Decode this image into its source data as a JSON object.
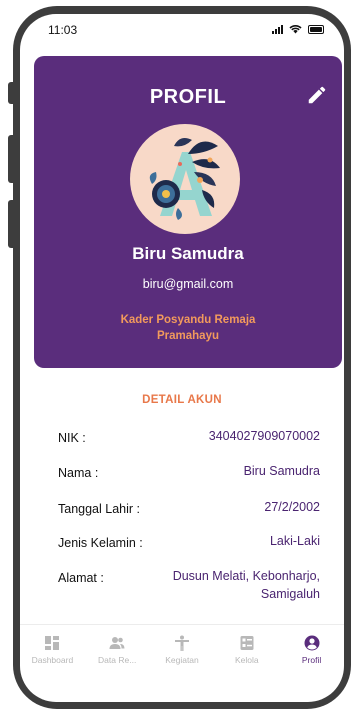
{
  "status_bar": {
    "time": "11:03"
  },
  "profile": {
    "title": "PROFIL",
    "name": "Biru Samudra",
    "email": "biru@gmail.com",
    "role_line1": "Kader Posyandu Remaja",
    "role_line2": "Pramahayu"
  },
  "details": {
    "heading": "DETAIL AKUN",
    "rows": [
      {
        "label": "NIK :",
        "value": "3404027909070002"
      },
      {
        "label": "Nama :",
        "value": "Biru Samudra"
      },
      {
        "label": "Tanggal Lahir :",
        "value": "27/2/2002"
      },
      {
        "label": "Jenis Kelamin :",
        "value": "Laki-Laki"
      },
      {
        "label": "Alamat :",
        "value_line1": "Dusun Melati, Kebonharjo,",
        "value_line2": "Samigaluh"
      }
    ]
  },
  "nav": {
    "items": [
      {
        "label": "Dashboard",
        "icon": "dashboard-icon",
        "active": false
      },
      {
        "label": "Data Re...",
        "icon": "users-icon",
        "active": false
      },
      {
        "label": "Kegiatan",
        "icon": "person-icon",
        "active": false
      },
      {
        "label": "Kelola",
        "icon": "manage-icon",
        "active": false
      },
      {
        "label": "Profil",
        "icon": "profile-icon",
        "active": true
      }
    ]
  },
  "colors": {
    "primary": "#5a2d7c",
    "accent": "#e8784a",
    "inactive": "#b8b8b8"
  }
}
